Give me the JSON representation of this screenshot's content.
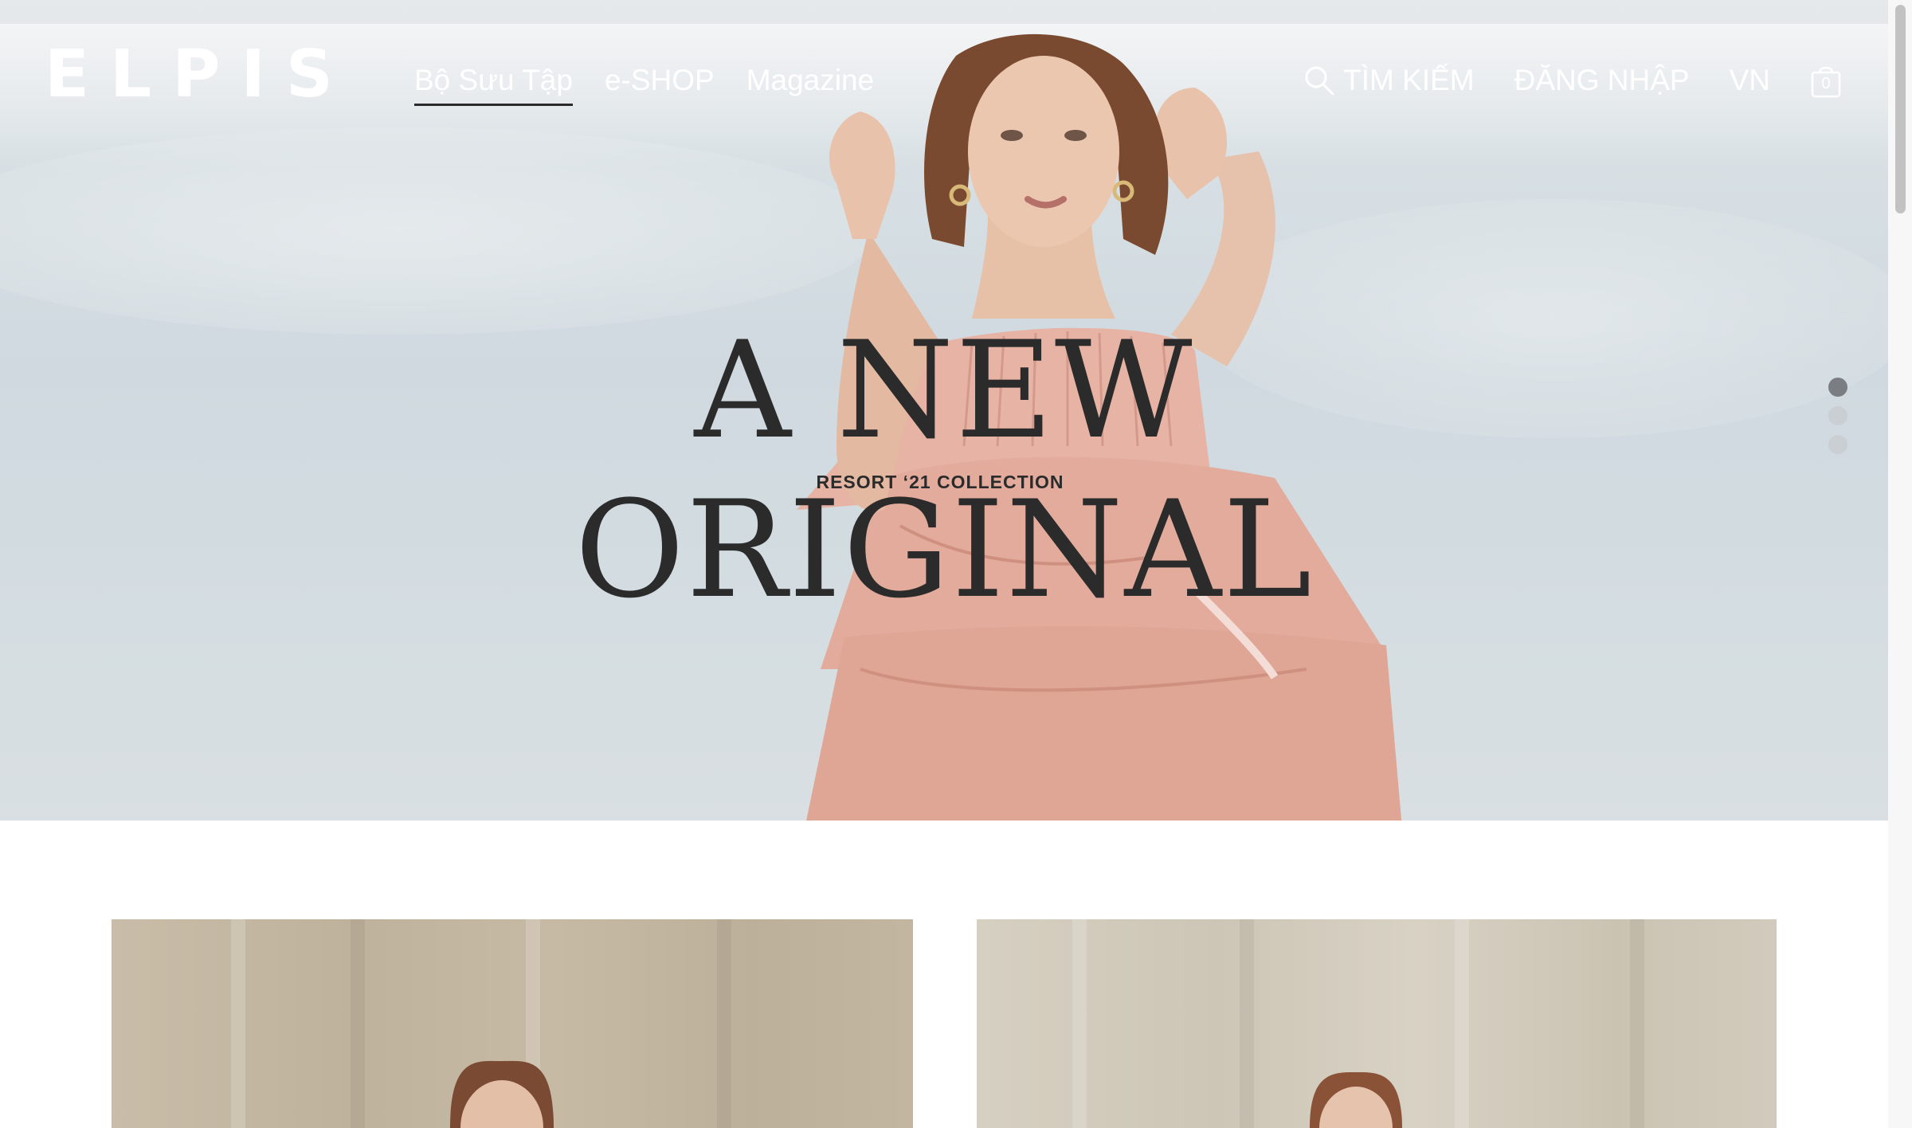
{
  "brand": {
    "logo_letters": [
      "E",
      "L",
      "P",
      "I",
      "S"
    ]
  },
  "nav": {
    "left": [
      {
        "label": "Bộ Sưu Tập",
        "active": true
      },
      {
        "label": "e-SHOP",
        "active": false
      },
      {
        "label": "Magazine",
        "active": false
      }
    ],
    "search_label": "TÌM KIẾM",
    "login_label": "ĐĂNG NHẬP",
    "language": "VN",
    "cart_count": "0"
  },
  "hero": {
    "title": "A NEW ORIGINAL",
    "subtitle": "RESORT ‘21 COLLECTION",
    "slides_total": 3,
    "active_slide": 1
  },
  "colors": {
    "nav_text": "#ffffff",
    "hero_text": "#2b2b2b",
    "dress": "#e8b4a6",
    "sky": "#d3dce1"
  }
}
